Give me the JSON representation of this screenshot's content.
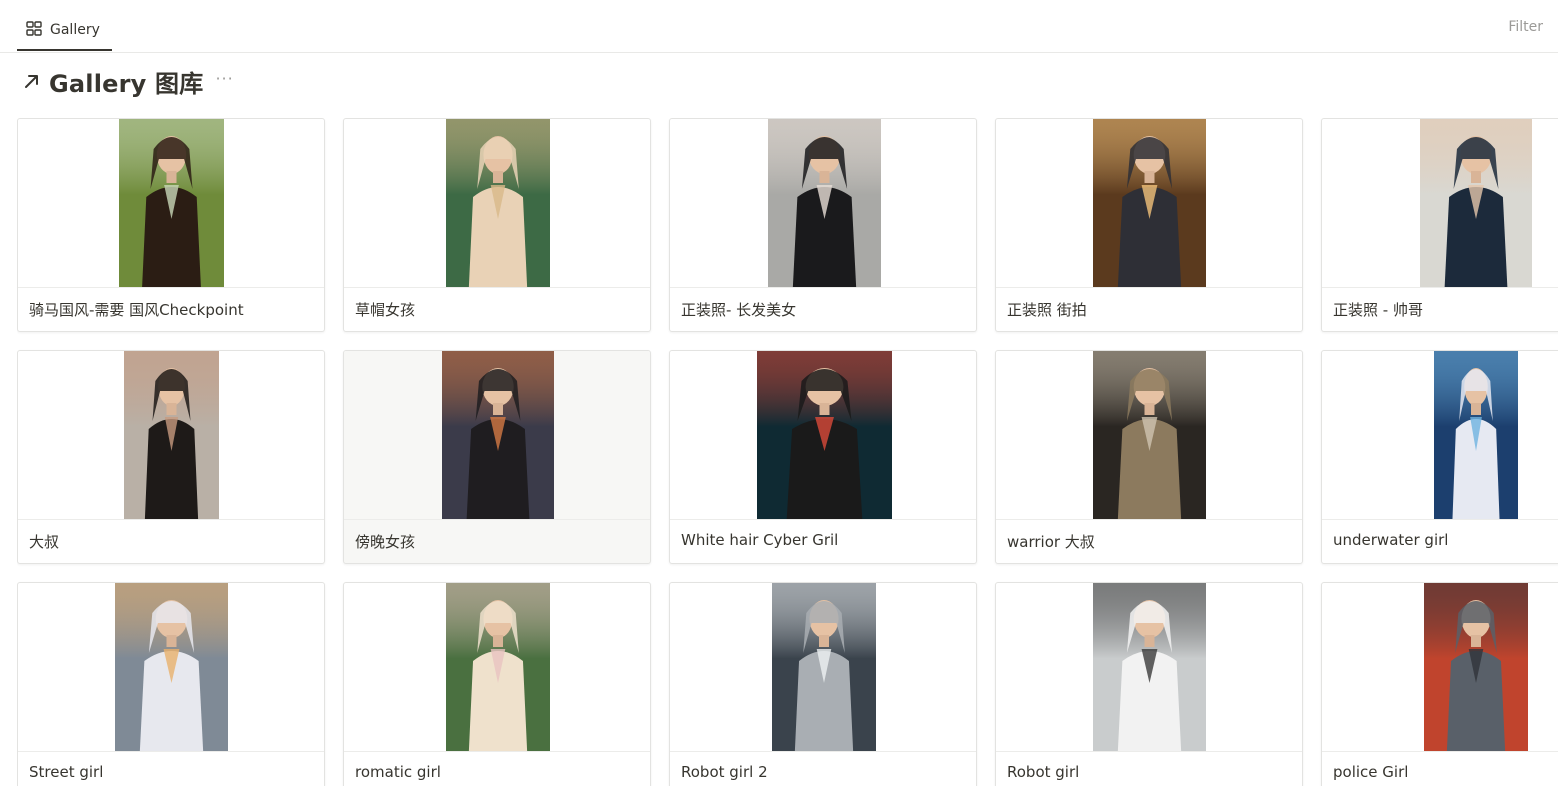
{
  "tabs": [
    {
      "label": "Gallery",
      "icon": "gallery-grid-icon"
    }
  ],
  "filter_label": "Filter",
  "page_title": "Gallery 图库",
  "more_label": "···",
  "cards": [
    {
      "caption": "骑马国风-需要 国风Checkpoint",
      "colors": {
        "bg": "#6f8b3a",
        "fg": "#2b1d14",
        "accent": "#c9d8b8"
      }
    },
    {
      "caption": "草帽女孩",
      "colors": {
        "bg": "#3d6a45",
        "fg": "#e9d2b6",
        "accent": "#d8b98a"
      }
    },
    {
      "caption": "正装照- 长发美女",
      "colors": {
        "bg": "#a9a9a6",
        "fg": "#1a1a1c",
        "accent": "#e9dfd7"
      }
    },
    {
      "caption": "正装照 街拍",
      "colors": {
        "bg": "#5b3a1e",
        "fg": "#2e2f36",
        "accent": "#f2c27a"
      }
    },
    {
      "caption": "正装照 - 帅哥",
      "colors": {
        "bg": "#d9d8d2",
        "fg": "#1c2a3b",
        "accent": "#e5c7ad"
      }
    },
    {
      "caption": "大叔",
      "colors": {
        "bg": "#b9b0a6",
        "fg": "#1e1a18",
        "accent": "#c79a80"
      }
    },
    {
      "caption": "傍晚女孩",
      "colors": {
        "bg": "#3b3b4a",
        "fg": "#1f1d20",
        "accent": "#d47a45"
      }
    },
    {
      "caption": "White hair Cyber Gril",
      "colors": {
        "bg": "#0f2a33",
        "fg": "#1a1a1a",
        "accent": "#d94a3a"
      }
    },
    {
      "caption": "warrior 大叔",
      "colors": {
        "bg": "#2a2622",
        "fg": "#8c7a5e",
        "accent": "#cfc4b0"
      }
    },
    {
      "caption": "underwater girl",
      "colors": {
        "bg": "#1c3f6e",
        "fg": "#e6e9f2",
        "accent": "#6fb3e0"
      }
    },
    {
      "caption": "Street girl",
      "colors": {
        "bg": "#7f8a96",
        "fg": "#e7e8ee",
        "accent": "#e8b06c"
      }
    },
    {
      "caption": "romatic girl",
      "colors": {
        "bg": "#4a7040",
        "fg": "#efe1cc",
        "accent": "#e9c3c1"
      }
    },
    {
      "caption": "Robot girl 2",
      "colors": {
        "bg": "#3a434c",
        "fg": "#a9aeb3",
        "accent": "#eef1f3"
      }
    },
    {
      "caption": "Robot girl",
      "colors": {
        "bg": "#c9cccd",
        "fg": "#f2f2f2",
        "accent": "#3a3a3a"
      }
    },
    {
      "caption": "police Girl",
      "colors": {
        "bg": "#c0442d",
        "fg": "#596069",
        "accent": "#2f333a"
      }
    }
  ]
}
